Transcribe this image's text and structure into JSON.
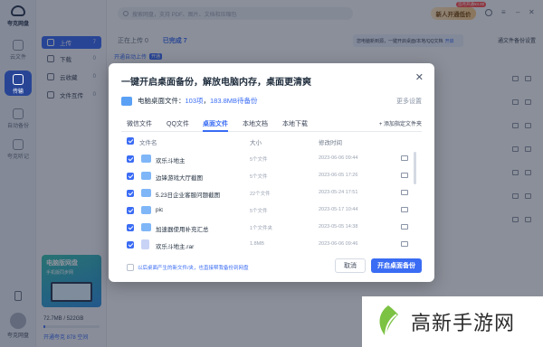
{
  "app": {
    "name": "夸克网盘"
  },
  "rail": {
    "items": [
      {
        "label": "云文件",
        "active": false
      },
      {
        "label": "传输",
        "active": true
      },
      {
        "label": "自动备份",
        "active": false
      },
      {
        "label": "夸克听记",
        "active": false
      }
    ],
    "bottom_label": "夸克网盘"
  },
  "sidebar": {
    "items": [
      {
        "label": "上传",
        "count": "7",
        "active": true
      },
      {
        "label": "下载",
        "count": "0",
        "active": false
      },
      {
        "label": "云收藏",
        "count": "0",
        "active": false
      },
      {
        "label": "文件互传",
        "count": "0",
        "active": false
      }
    ],
    "banner_title": "电脑版网盘",
    "banner_sub": "手机版同步网",
    "storage_text": "72.7MB / 522GB",
    "storage_fraction": 0.01,
    "upgrade": "开通夸克 878 空间"
  },
  "topbar": {
    "search_placeholder": "搜索网盘，支持 PDF、图片、文档和压缩包",
    "vip_button": "新人开通低价",
    "vip_badge": "首月开通¥4.90"
  },
  "main": {
    "tab_uploading": "正在上传 0",
    "tab_done": "已完成 7",
    "notice_text": "您电脑新到源，一键开启桌面/本地/QQ文档",
    "notice_tag": "开启",
    "safe_set": "通文件备份设置",
    "open_row": "开通自动上传",
    "open_tag": "开通"
  },
  "modal": {
    "title": "一键开启桌面备份，解放电脑内存，桌面更清爽",
    "summary_prefix": "电脑桌面文件：",
    "summary_count": "103项",
    "summary_sep": "，",
    "summary_size": "183.8MB待备份",
    "more": "更多设置",
    "tabs": [
      {
        "label": "微信文件",
        "active": false
      },
      {
        "label": "QQ文件",
        "active": false
      },
      {
        "label": "桌面文件",
        "active": true
      },
      {
        "label": "本地文档",
        "active": false
      },
      {
        "label": "本地下载",
        "active": false
      }
    ],
    "add_folder": "+ 添加指定文件夹",
    "col_name": "文件名",
    "col_size": "大小",
    "col_date": "修改时间",
    "rows": [
      {
        "name": "欢乐斗地主",
        "size": "5个文件",
        "date": "2023-06-06 09:44",
        "type": "folder"
      },
      {
        "name": "边锋游戏大厅截图",
        "size": "5个文件",
        "date": "2023-06-05 17:26",
        "type": "folder"
      },
      {
        "name": "5.23日企业客服问题截图",
        "size": "22个文件",
        "date": "2023-05-24 17:51",
        "type": "folder"
      },
      {
        "name": "pic",
        "size": "5个文件",
        "date": "2023-05-17 10:44",
        "type": "folder"
      },
      {
        "name": "加速器使用补充汇总",
        "size": "1个文件夹",
        "date": "2023-05-05 14:38",
        "type": "folder"
      },
      {
        "name": "欢乐斗地主.rar",
        "size": "1.8MB",
        "date": "2023-06-06 09:46",
        "type": "file"
      }
    ],
    "footer_note": "以后桌面产生的新文件/夹，也直接帮我备份到网盘",
    "cancel": "取消",
    "start": "开启桌面备份"
  },
  "watermark": {
    "text": "高新手游网"
  }
}
